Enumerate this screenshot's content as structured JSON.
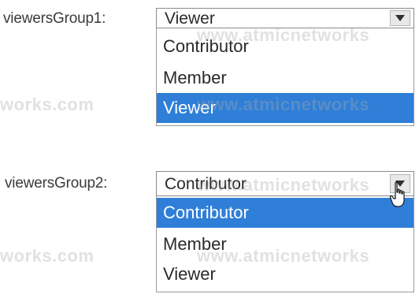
{
  "groups": [
    {
      "label": "viewersGroup1:",
      "selected_value": "Viewer",
      "options": [
        {
          "label": "Contributor",
          "highlighted": false
        },
        {
          "label": "Member",
          "highlighted": false
        },
        {
          "label": "Viewer",
          "highlighted": true
        }
      ]
    },
    {
      "label": "viewersGroup2:",
      "selected_value": "Contributor",
      "options": [
        {
          "label": "Contributor",
          "highlighted": true
        },
        {
          "label": "Member",
          "highlighted": false
        },
        {
          "label": "Viewer",
          "highlighted": false
        }
      ]
    }
  ],
  "watermark": {
    "left": "works.com",
    "right": "www.atmicnetworks"
  },
  "colors": {
    "highlight": "#2f7fd8",
    "highlight_text": "#ffffff",
    "border": "#8a8a8a"
  },
  "icons": {
    "dropdown": "chevron-down-icon",
    "cursor": "hand-pointer-icon"
  }
}
